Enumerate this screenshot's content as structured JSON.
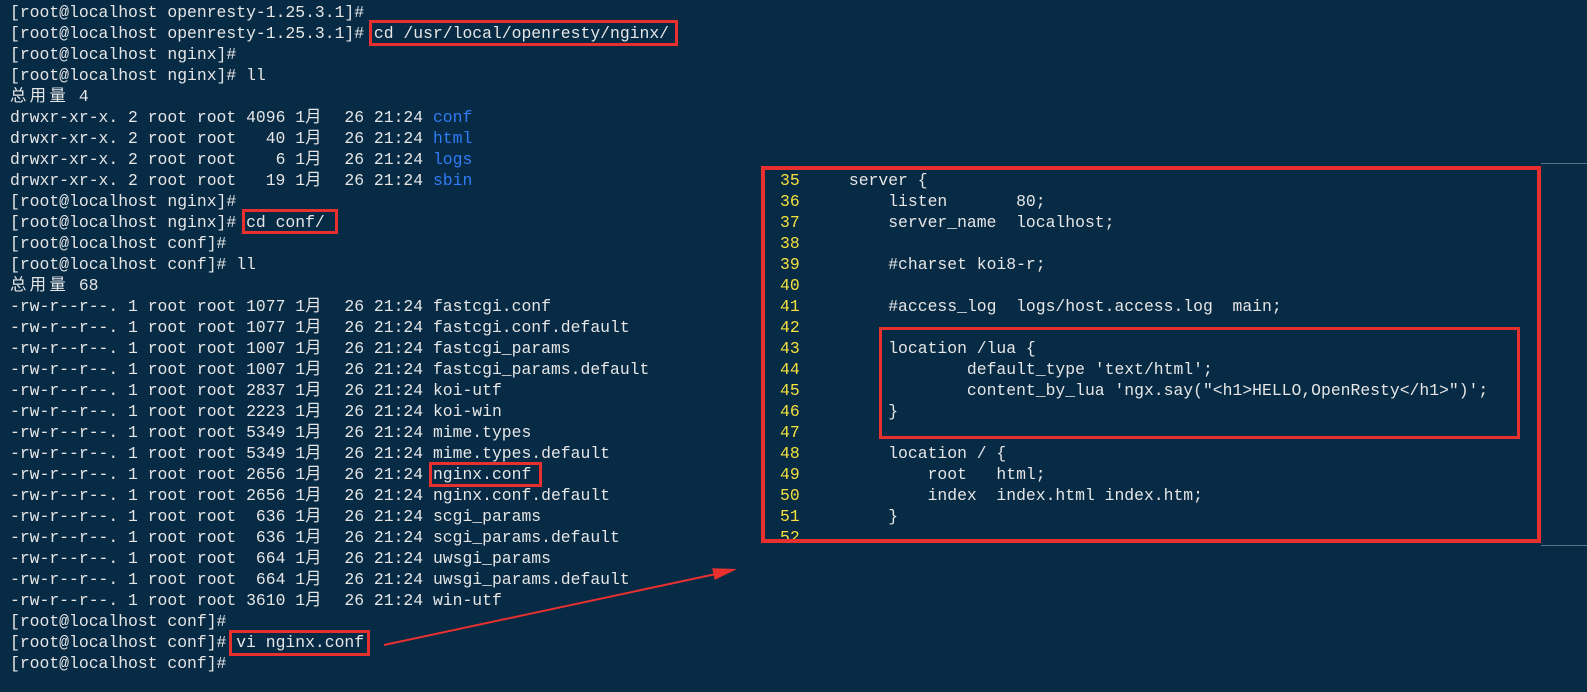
{
  "colors": {
    "terminal_background": "#072a45",
    "text": "#e6e6e6",
    "directory": "#2f7cf6",
    "line_number": "#f4e13f",
    "annotation": "#e8302f"
  },
  "left_terminal": {
    "lines": [
      {
        "prompt": "[root@localhost openresty-1.25.3.1]#"
      },
      {
        "prompt": "[root@localhost openresty-1.25.3.1]#",
        "command": "cd /usr/local/openresty/nginx/"
      },
      {
        "prompt": "[root@localhost nginx]#"
      },
      {
        "prompt": "[root@localhost nginx]#",
        "command": "ll"
      },
      {
        "label": "总用量",
        "value": "4"
      },
      {
        "perms": "drwxr-xr-x.",
        "links": "2",
        "owner": "root",
        "group": "root",
        "size": "4096",
        "month": "1月",
        "day": "26",
        "time": "21:24",
        "name": "conf",
        "directory": true
      },
      {
        "perms": "drwxr-xr-x.",
        "links": "2",
        "owner": "root",
        "group": "root",
        "size": "40",
        "month": "1月",
        "day": "26",
        "time": "21:24",
        "name": "html",
        "directory": true
      },
      {
        "perms": "drwxr-xr-x.",
        "links": "2",
        "owner": "root",
        "group": "root",
        "size": "6",
        "month": "1月",
        "day": "26",
        "time": "21:24",
        "name": "logs",
        "directory": true
      },
      {
        "perms": "drwxr-xr-x.",
        "links": "2",
        "owner": "root",
        "group": "root",
        "size": "19",
        "month": "1月",
        "day": "26",
        "time": "21:24",
        "name": "sbin",
        "directory": true
      },
      {
        "prompt": "[root@localhost nginx]#"
      },
      {
        "prompt": "[root@localhost nginx]#",
        "command": "cd conf/"
      },
      {
        "prompt": "[root@localhost conf]#"
      },
      {
        "prompt": "[root@localhost conf]#",
        "command": "ll"
      },
      {
        "label": "总用量",
        "value": "68"
      },
      {
        "perms": "-rw-r--r--.",
        "links": "1",
        "owner": "root",
        "group": "root",
        "size": "1077",
        "month": "1月",
        "day": "26",
        "time": "21:24",
        "name": "fastcgi.conf"
      },
      {
        "perms": "-rw-r--r--.",
        "links": "1",
        "owner": "root",
        "group": "root",
        "size": "1077",
        "month": "1月",
        "day": "26",
        "time": "21:24",
        "name": "fastcgi.conf.default"
      },
      {
        "perms": "-rw-r--r--.",
        "links": "1",
        "owner": "root",
        "group": "root",
        "size": "1007",
        "month": "1月",
        "day": "26",
        "time": "21:24",
        "name": "fastcgi_params"
      },
      {
        "perms": "-rw-r--r--.",
        "links": "1",
        "owner": "root",
        "group": "root",
        "size": "1007",
        "month": "1月",
        "day": "26",
        "time": "21:24",
        "name": "fastcgi_params.default"
      },
      {
        "perms": "-rw-r--r--.",
        "links": "1",
        "owner": "root",
        "group": "root",
        "size": "2837",
        "month": "1月",
        "day": "26",
        "time": "21:24",
        "name": "koi-utf"
      },
      {
        "perms": "-rw-r--r--.",
        "links": "1",
        "owner": "root",
        "group": "root",
        "size": "2223",
        "month": "1月",
        "day": "26",
        "time": "21:24",
        "name": "koi-win"
      },
      {
        "perms": "-rw-r--r--.",
        "links": "1",
        "owner": "root",
        "group": "root",
        "size": "5349",
        "month": "1月",
        "day": "26",
        "time": "21:24",
        "name": "mime.types"
      },
      {
        "perms": "-rw-r--r--.",
        "links": "1",
        "owner": "root",
        "group": "root",
        "size": "5349",
        "month": "1月",
        "day": "26",
        "time": "21:24",
        "name": "mime.types.default"
      },
      {
        "perms": "-rw-r--r--.",
        "links": "1",
        "owner": "root",
        "group": "root",
        "size": "2656",
        "month": "1月",
        "day": "26",
        "time": "21:24",
        "name": "nginx.conf"
      },
      {
        "perms": "-rw-r--r--.",
        "links": "1",
        "owner": "root",
        "group": "root",
        "size": "2656",
        "month": "1月",
        "day": "26",
        "time": "21:24",
        "name": "nginx.conf.default"
      },
      {
        "perms": "-rw-r--r--.",
        "links": "1",
        "owner": "root",
        "group": "root",
        "size": "636",
        "month": "1月",
        "day": "26",
        "time": "21:24",
        "name": "scgi_params"
      },
      {
        "perms": "-rw-r--r--.",
        "links": "1",
        "owner": "root",
        "group": "root",
        "size": "636",
        "month": "1月",
        "day": "26",
        "time": "21:24",
        "name": "scgi_params.default"
      },
      {
        "perms": "-rw-r--r--.",
        "links": "1",
        "owner": "root",
        "group": "root",
        "size": "664",
        "month": "1月",
        "day": "26",
        "time": "21:24",
        "name": "uwsgi_params"
      },
      {
        "perms": "-rw-r--r--.",
        "links": "1",
        "owner": "root",
        "group": "root",
        "size": "664",
        "month": "1月",
        "day": "26",
        "time": "21:24",
        "name": "uwsgi_params.default"
      },
      {
        "perms": "-rw-r--r--.",
        "links": "1",
        "owner": "root",
        "group": "root",
        "size": "3610",
        "month": "1月",
        "day": "26",
        "time": "21:24",
        "name": "win-utf"
      },
      {
        "prompt": "[root@localhost conf]#"
      },
      {
        "prompt": "[root@localhost conf]#",
        "command": "vi nginx.conf"
      },
      {
        "prompt": "[root@localhost conf]#"
      }
    ]
  },
  "vi_editor": {
    "lines": [
      {
        "number": "35",
        "text": "    server {"
      },
      {
        "number": "36",
        "text": "        listen       80;"
      },
      {
        "number": "37",
        "text": "        server_name  localhost;"
      },
      {
        "number": "38"
      },
      {
        "number": "39",
        "text": "        #charset koi8-r;"
      },
      {
        "number": "40"
      },
      {
        "number": "41",
        "text": "        #access_log  logs/host.access.log  main;"
      },
      {
        "number": "42"
      },
      {
        "number": "43",
        "text": "        location /lua {"
      },
      {
        "number": "44",
        "text": "                default_type 'text/html';"
      },
      {
        "number": "45",
        "text": "                content_by_lua 'ngx.say(\"<h1>HELLO,OpenResty</h1>\")';"
      },
      {
        "number": "46",
        "text": "        }"
      },
      {
        "number": "47"
      },
      {
        "number": "48",
        "text": "        location / {"
      },
      {
        "number": "49",
        "text": "            root   html;"
      },
      {
        "number": "50",
        "text": "            index  index.html index.htm;"
      },
      {
        "number": "51",
        "text": "        }"
      },
      {
        "number": "52"
      }
    ]
  }
}
